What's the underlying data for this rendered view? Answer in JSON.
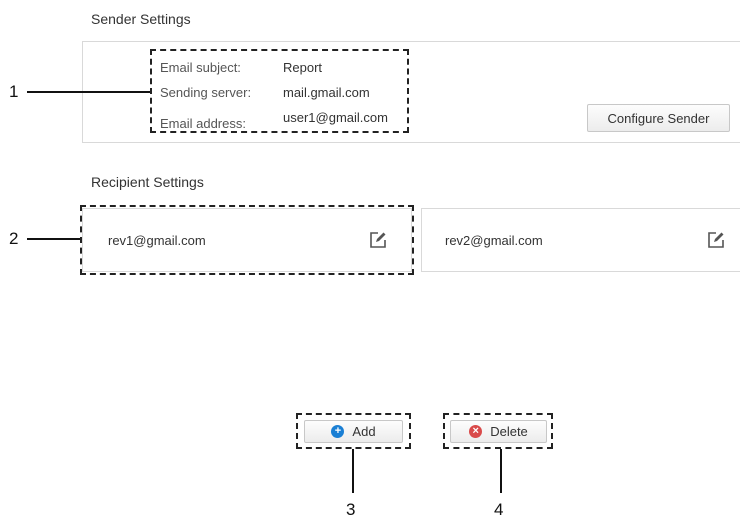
{
  "sender": {
    "title": "Sender Settings",
    "fields": [
      {
        "label": "Email subject:",
        "value": "Report"
      },
      {
        "label": "Sending server:",
        "value": "mail.gmail.com"
      },
      {
        "label": "Email address:",
        "value": "user1@gmail.com"
      }
    ],
    "configure_button": "Configure Sender"
  },
  "recipients": {
    "title": "Recipient Settings",
    "items": [
      {
        "email": "rev1@gmail.com",
        "icon": "edit-icon"
      },
      {
        "email": "rev2@gmail.com",
        "icon": "edit-icon"
      }
    ]
  },
  "actions": {
    "add_label": "Add",
    "delete_label": "Delete",
    "add_icon_color": "#1a7fd4",
    "delete_icon_color": "#d94a4a"
  },
  "callouts": [
    "1",
    "2",
    "3",
    "4"
  ]
}
